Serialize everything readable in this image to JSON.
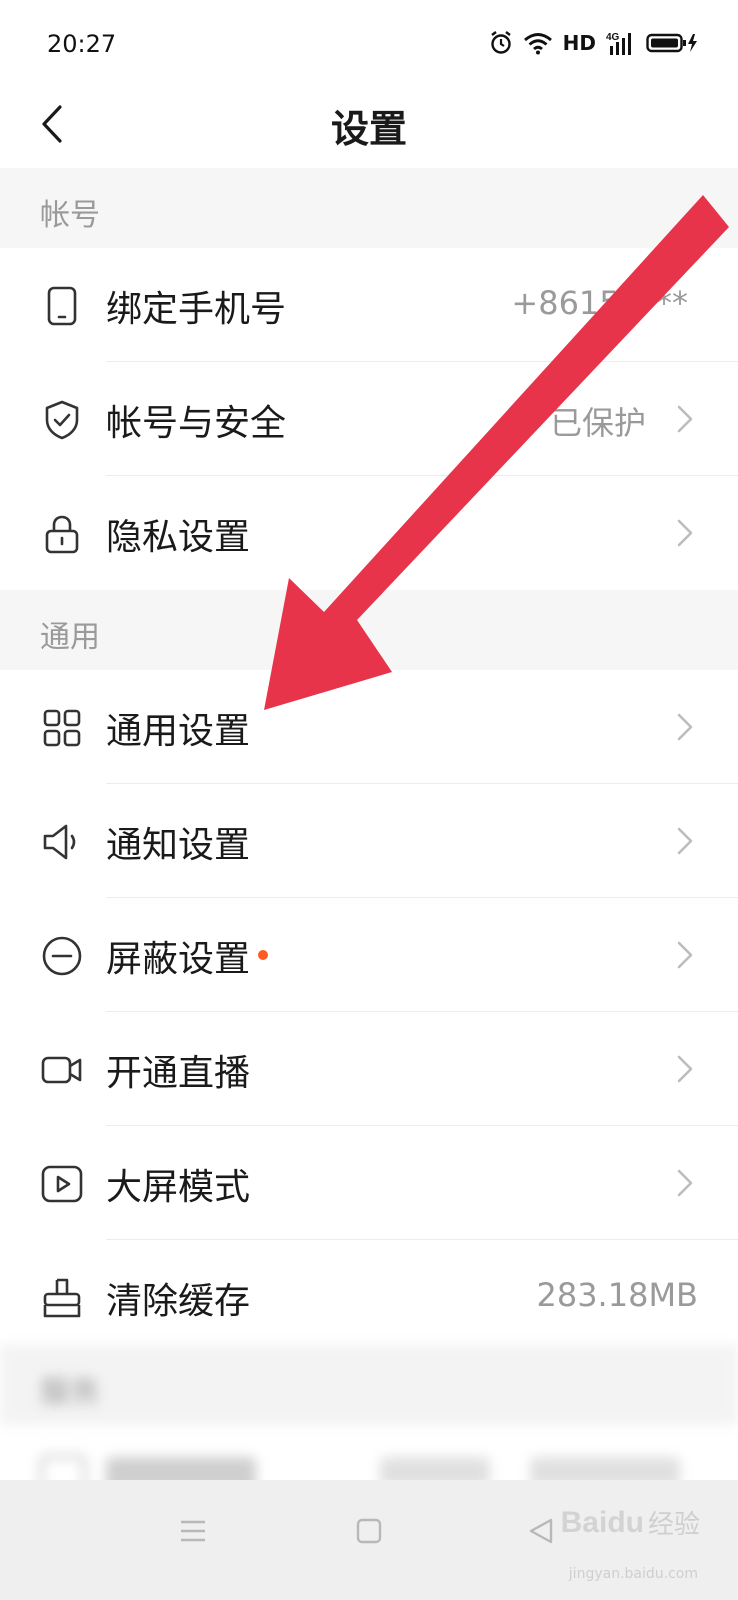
{
  "status_bar": {
    "time": "20:27",
    "hd": "HD",
    "network": "4G",
    "icons": [
      "alarm-icon",
      "wifi-icon",
      "signal-icon",
      "battery-icon"
    ]
  },
  "header": {
    "title": "设置",
    "back_icon": "chevron-left-icon"
  },
  "sections": {
    "account": {
      "title": "帐号",
      "items": [
        {
          "label": "绑定手机号",
          "value": "+86150***",
          "icon": "phone-icon",
          "arrow": false
        },
        {
          "label": "帐号与安全",
          "value": "已保护",
          "icon": "shield-icon",
          "arrow": true
        },
        {
          "label": "隐私设置",
          "value": "",
          "icon": "lock-icon",
          "arrow": true
        }
      ]
    },
    "general": {
      "title": "通用",
      "items": [
        {
          "label": "通用设置",
          "value": "",
          "icon": "grid-icon",
          "arrow": true
        },
        {
          "label": "通知设置",
          "value": "",
          "icon": "speaker-icon",
          "arrow": true
        },
        {
          "label": "屏蔽设置",
          "value": "",
          "icon": "block-icon",
          "arrow": true,
          "badge": "red-dot"
        },
        {
          "label": "开通直播",
          "value": "",
          "icon": "video-camera-icon",
          "arrow": true
        },
        {
          "label": "大屏模式",
          "value": "",
          "icon": "play-screen-icon",
          "arrow": true
        },
        {
          "label": "清除缓存",
          "value": "283.18MB",
          "icon": "broom-icon",
          "arrow": false
        }
      ]
    },
    "service": {
      "title": "服务"
    }
  },
  "watermark": {
    "logo": "Baidu",
    "text": "经验",
    "sub": "jingyan.baidu.com"
  },
  "colors": {
    "arrow": "#e8344a",
    "badge": "#ff5a1f",
    "section_bg": "#f6f6f6",
    "secondary_text": "#9a9a9a"
  }
}
